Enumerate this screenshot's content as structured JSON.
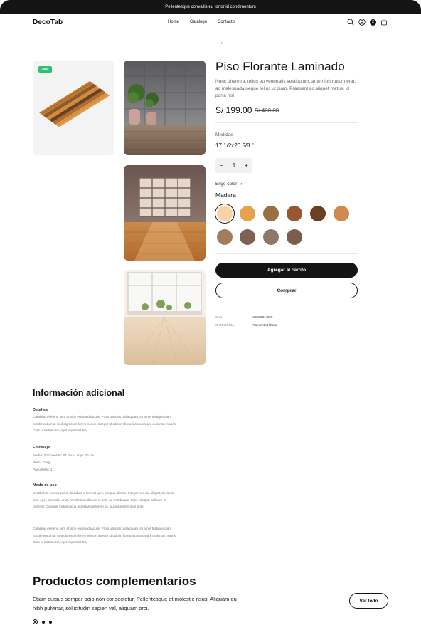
{
  "promo": "Pellentesque convallis eu tortor id condimentum",
  "header": {
    "logo": "DecoTab",
    "nav": [
      "Home",
      "Catálogo",
      "Contacto"
    ],
    "cart_count": "2"
  },
  "breadcrumb": "›",
  "product": {
    "discount": "-30%",
    "title": "Piso Florante Laminado",
    "description": "Nunc pharetra, tellus eu venenatis vestibulum, ante nibh rutrum erat, ac malesuada neque tellus ut diam. Praesent ac aliquet metus, id porta nisi.",
    "price": "S/ 199.00",
    "old_price": "S/ 400.00",
    "measures_label": "Medidas",
    "measures_value": "17 1/2x20 5/8 \"",
    "qty_minus": "−",
    "qty_value": "1",
    "qty_plus": "+",
    "color_label": "Elige color",
    "color_chevron": "›",
    "color_selected": "Madera",
    "swatches": [
      "#f9d2a8",
      "#e8a24e",
      "#9a7040",
      "#96592f",
      "#6c3f25",
      "#d3894d",
      "#a37c5c",
      "#7e6152",
      "#8d7767",
      "#7c5d4c"
    ],
    "add_to_cart": "Agregar al carrito",
    "buy": "Comprar",
    "sku_label": "SKU",
    "sku_value": "MD232344009",
    "category_label": "CATEGORÍA",
    "category_value": "Praesent et libero"
  },
  "info": {
    "title": "Información adicional",
    "details_h": "Detalles",
    "details_p": "Curabitur eleifend sem at nibh euismod iaculis. Proin ultricies nulla quam, sit amet tristique diam condimentum a. Sed dignissim lorem neque. Integer id odio in libero lacinia ornare quis non mauris. Cras ut luctus orci, eget imperdiet leo.",
    "pack_h": "Embalaje",
    "pack_lines": [
      "Ancho: 20 cm • Alto: 64 cm • Largo: 40 cm",
      "Peso: 21 kg",
      "Paquete(s): 1"
    ],
    "use_h": "Modo de uso",
    "use_p1": "Vestibulum massa purus, tincidunt a laoreet quis, tempus id ante. Integer nec dui aliquet, tincidunt ante eget, convallis enim. Vestibulum dictum et ante ac vestibulum. Cras volutpat at libero in pulvinar. Quisque metus lacus, egestas vel lorem ac, auctor elementum ante.",
    "use_p2": "Curabitur eleifend sem at nibh euismod iaculis. Proin ultricies nulla quam, sit amet tristique diam condimentum a. Sed dignissim lorem neque. Integer id odio in libero lacinia ornare quis non mauris. Cras ut luctus orci, eget imperdiet leo."
  },
  "complementary": {
    "title": "Productos complementarios",
    "description": "Etiam cursus semper odio non consectetur. Pellentesque et molestie risus. Aliquam eu nibh pulvinar, sollicitudin sapien vel, aliquam orci.",
    "view_all": "Ver todo"
  },
  "icons": {
    "search": "search-icon",
    "user": "user-icon",
    "cart": "cart-icon"
  }
}
